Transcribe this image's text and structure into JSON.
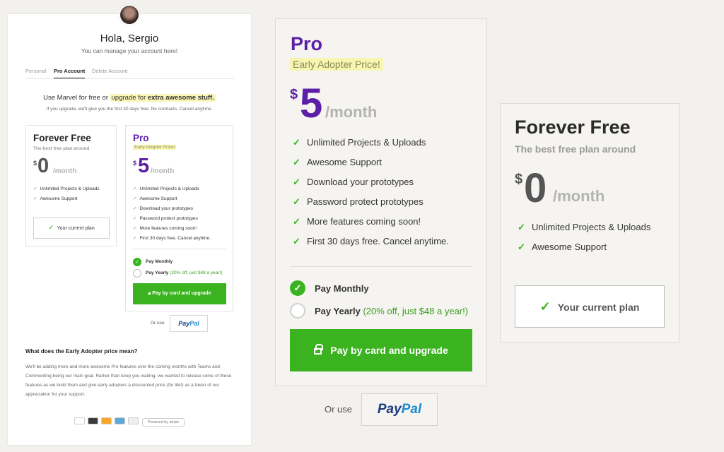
{
  "account": {
    "greeting": "Hola, Sergio",
    "subtitle": "You can manage your account here!",
    "tabs": [
      "Personal",
      "Pro Account",
      "Delete Account"
    ],
    "active_tab": "Pro Account"
  },
  "intro": {
    "prefix": "Use Marvel for free or",
    "highlight_prefix": "upgrade for",
    "highlight_bold": "extra awesome stuff.",
    "sub": "If you upgrade, we'll give you the first 30 days free. No contracts. Cancel anytime."
  },
  "plans": {
    "pro": {
      "name": "Pro",
      "badge": "Early Adopter Price!",
      "currency": "$",
      "price": "5",
      "period": "/month",
      "features": [
        "Unlimited Projects & Uploads",
        "Awesome Support",
        "Download your prototypes",
        "Password protect prototypes",
        "More features coming soon!",
        "First 30 days free. Cancel anytime."
      ],
      "billing": {
        "monthly_label": "Pay Monthly",
        "yearly_label": "Pay Yearly",
        "yearly_note": "(20% off, just $48 a year!)",
        "selected": "monthly"
      },
      "pay_button": "Pay by card and upgrade"
    },
    "free": {
      "name": "Forever Free",
      "tagline": "The best free plan around",
      "currency": "$",
      "price": "0",
      "period": "/month",
      "features": [
        "Unlimited Projects & Uploads",
        "Awesome Support"
      ],
      "current_button": "Your current plan"
    }
  },
  "alt_payment": {
    "or_use": "Or use",
    "paypal_a": "Pay",
    "paypal_b": "Pal"
  },
  "faq": {
    "question": "What does the Early Adopter price mean?",
    "answer": "We'll be adding more and more awesome Pro features over the coming months with Teams and Commenting being our main goal. Rather than keep you waiting, we wanted to release some of these features as we build them and give early adopters a discounted price (for life!) as a token of our appreciation for your support."
  },
  "footer": {
    "card_icons": [
      "diners-icon",
      "mastercard-icon",
      "visa-icon",
      "amex-icon",
      "discover-icon"
    ],
    "powered_by": "Powered by stripe"
  },
  "colors": {
    "accent_purple": "#5c1fa8",
    "accent_green": "#3bb320",
    "highlight_yellow": "#f8f5b0",
    "page_bg": "#f2f1ed"
  }
}
